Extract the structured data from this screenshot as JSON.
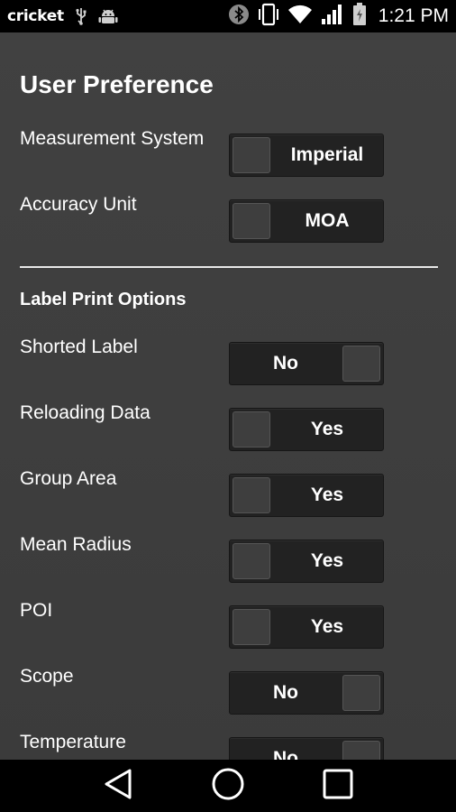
{
  "status_bar": {
    "carrier": "cricket",
    "icons": [
      "usb-icon",
      "android-debug-icon",
      "bluetooth-icon",
      "vibrate-icon",
      "wifi-icon",
      "signal-icon",
      "battery-icon"
    ],
    "time": "1:21 PM"
  },
  "preferences": {
    "title": "User Preference",
    "rows": [
      {
        "label": "Measurement System",
        "value": "Imperial",
        "knob": "left"
      },
      {
        "label": "Accuracy Unit",
        "value": "MOA",
        "knob": "left"
      }
    ]
  },
  "label_options": {
    "title": "Label Print Options",
    "rows": [
      {
        "label": "Shorted Label",
        "value": "No",
        "knob": "right"
      },
      {
        "label": "Reloading Data",
        "value": "Yes",
        "knob": "left"
      },
      {
        "label": "Group Area",
        "value": "Yes",
        "knob": "left"
      },
      {
        "label": "Mean Radius",
        "value": "Yes",
        "knob": "left"
      },
      {
        "label": "POI",
        "value": "Yes",
        "knob": "left"
      },
      {
        "label": "Scope",
        "value": "No",
        "knob": "right"
      },
      {
        "label": "Temperature",
        "value": "No",
        "knob": "right"
      }
    ]
  },
  "nav_bar": {
    "buttons": [
      "back-icon",
      "home-icon",
      "recents-icon"
    ]
  },
  "colors": {
    "background": "#3e3e3e",
    "toggle_bg": "#222222",
    "knob": "#3e3e3e",
    "text": "#ffffff"
  }
}
